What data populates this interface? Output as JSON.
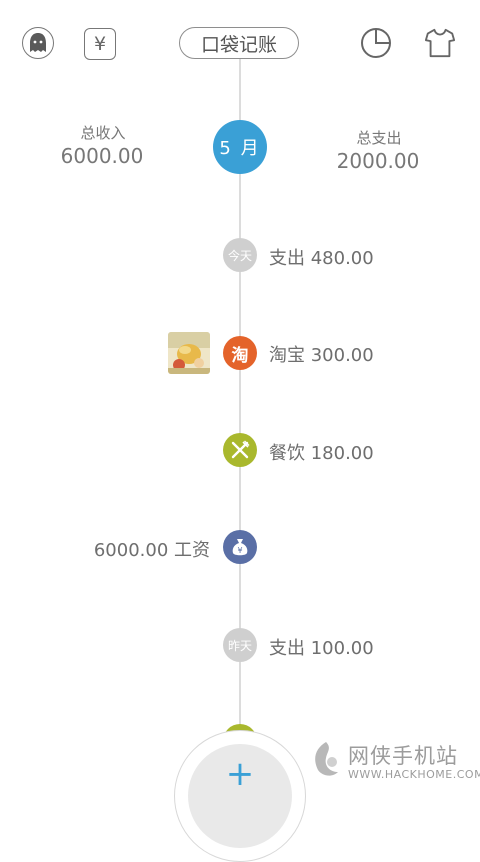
{
  "header": {
    "title": "口袋记账",
    "avatar_icon": "ghost-avatar-icon",
    "currency_icon": "yen-icon",
    "chart_icon": "pie-chart-icon",
    "theme_icon": "shirt-icon"
  },
  "summary": {
    "income_label": "总收入",
    "income_value": "6000.00",
    "expense_label": "总支出",
    "expense_value": "2000.00",
    "month": "5 月"
  },
  "timeline": [
    {
      "kind": "day",
      "badge": "今天",
      "text": "支出 480.00",
      "color": "#cfcfcf"
    },
    {
      "kind": "expense",
      "badge": "淘",
      "text": "淘宝 300.00",
      "color": "#e4632a",
      "has_photo": true
    },
    {
      "kind": "expense",
      "badge": "fork-knife-icon",
      "text": "餐饮 180.00",
      "color": "#a9b82d"
    },
    {
      "kind": "income",
      "badge": "money-bag-icon",
      "text": "6000.00 工资",
      "color": "#5a6fa6"
    },
    {
      "kind": "day",
      "badge": "昨天",
      "text": "支出 100.00",
      "color": "#cfcfcf"
    }
  ],
  "fab": {
    "label": "+"
  },
  "watermark": {
    "title": "网侠手机站",
    "url": "WWW.HACKHOME.COM"
  }
}
